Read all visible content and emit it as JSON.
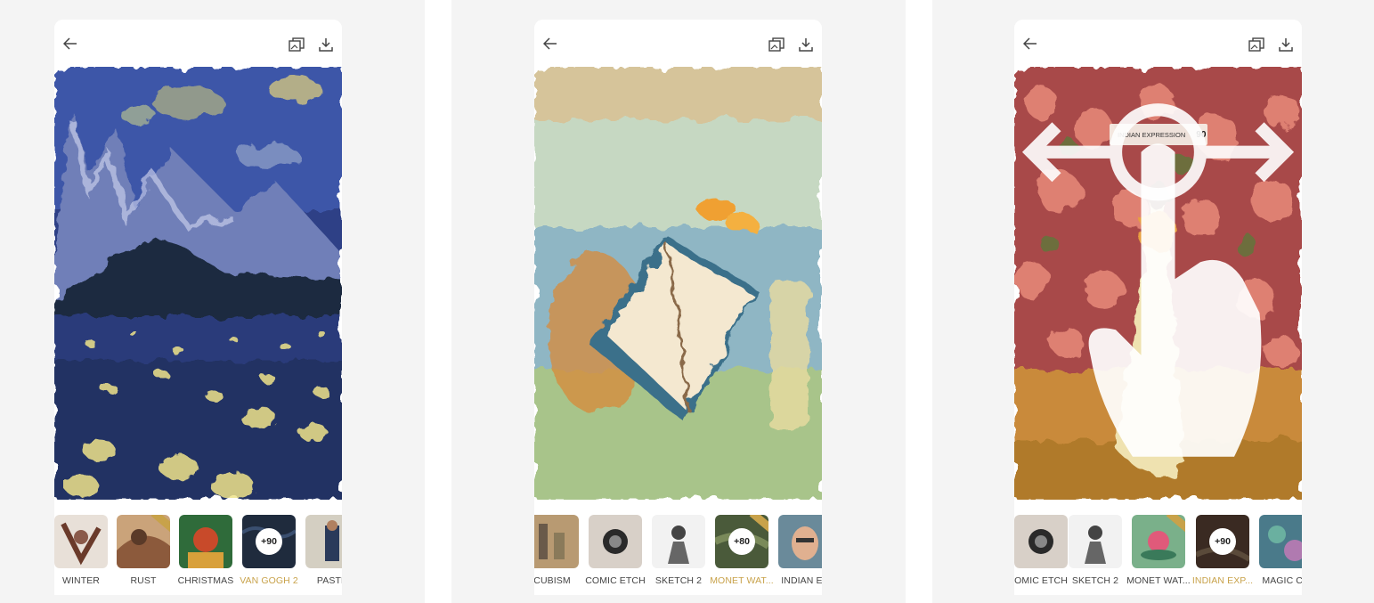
{
  "colors": {
    "panel_background": "#f4f4f4",
    "accent_gold": "#c8a24a",
    "label_text": "#444444"
  },
  "screens": [
    {
      "icons": [
        "back-arrow-icon",
        "compare-icon",
        "download-icon"
      ],
      "artwork": "van-gogh-style mountain night landscape",
      "filters": [
        {
          "label": "WINTER",
          "active": false
        },
        {
          "label": "RUST",
          "active": false
        },
        {
          "label": "CHRISTMAS",
          "active": false
        },
        {
          "label": "VAN GOGH 2",
          "active": true,
          "badge": "+90"
        },
        {
          "label": "PASTE",
          "active": false
        }
      ]
    },
    {
      "icons": [
        "back-arrow-icon",
        "compare-icon",
        "download-icon"
      ],
      "artwork": "monet watercolor picnic with book",
      "filters": [
        {
          "label": "CUBISM",
          "active": false
        },
        {
          "label": "COMIC ETCH",
          "active": false
        },
        {
          "label": "SKETCH 2",
          "active": false
        },
        {
          "label": "MONET WAT...",
          "active": true,
          "badge": "+80"
        },
        {
          "label": "INDIAN EX",
          "active": false
        }
      ]
    },
    {
      "icons": [
        "back-arrow-icon",
        "compare-icon",
        "download-icon"
      ],
      "artwork": "woman walking before flowering bush",
      "intensity": {
        "label": "INDIAN EXPRESSION",
        "value": "90"
      },
      "filters": [
        {
          "label": "OMIC ETCH",
          "active": false
        },
        {
          "label": "SKETCH 2",
          "active": false
        },
        {
          "label": "MONET WAT...",
          "active": false
        },
        {
          "label": "INDIAN EXP...",
          "active": true,
          "badge": "+90"
        },
        {
          "label": "MAGIC CU",
          "active": false
        }
      ]
    }
  ]
}
